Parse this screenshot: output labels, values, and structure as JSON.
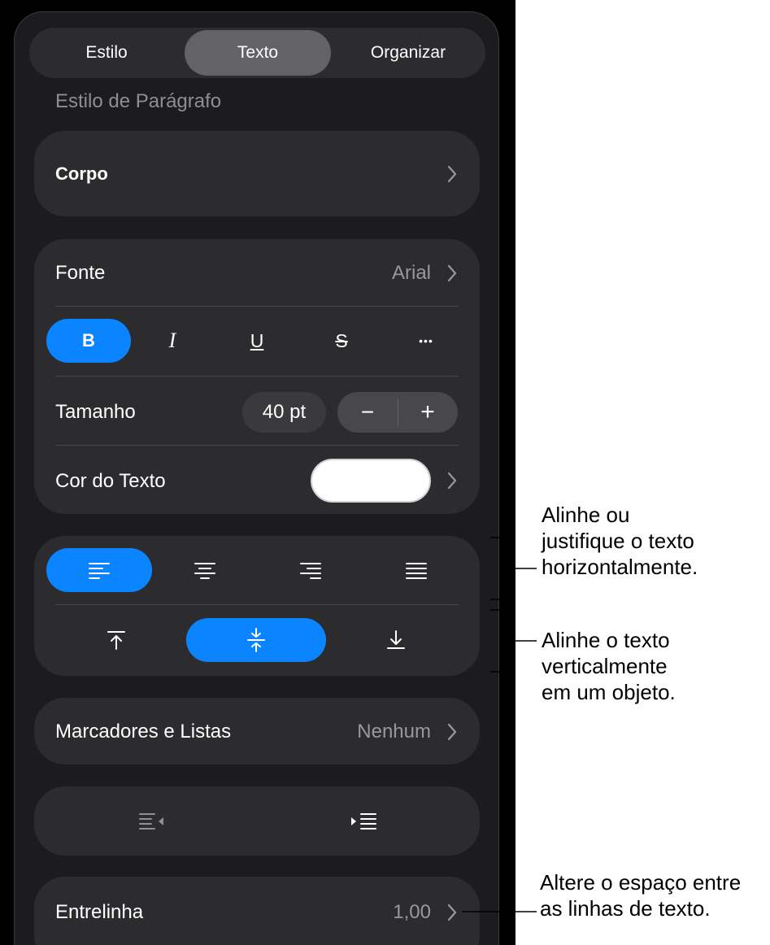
{
  "tabs": [
    {
      "label": "Estilo",
      "selected": false
    },
    {
      "label": "Texto",
      "selected": true
    },
    {
      "label": "Organizar",
      "selected": false
    }
  ],
  "paragraph_style": {
    "heading": "Estilo de Parágrafo",
    "value": "Corpo"
  },
  "font": {
    "label": "Fonte",
    "value": "Arial",
    "styles": [
      {
        "label": "B",
        "name": "bold",
        "active": true
      },
      {
        "label": "I",
        "name": "italic",
        "active": false
      },
      {
        "label": "U",
        "name": "underline",
        "active": false
      },
      {
        "label": "S",
        "name": "strikethrough",
        "active": false
      },
      {
        "label": "•••",
        "name": "more",
        "active": false
      }
    ]
  },
  "size": {
    "label": "Tamanho",
    "value": "40 pt",
    "minus": "−",
    "plus": "+"
  },
  "text_color": {
    "label": "Cor do Texto",
    "color": "#ffffff"
  },
  "alignment": {
    "horizontal": [
      "align-left",
      "align-center",
      "align-right",
      "justify"
    ],
    "horizontal_selected": "align-left",
    "vertical": [
      "align-top",
      "align-middle",
      "align-bottom"
    ],
    "vertical_selected": "align-middle"
  },
  "bullets": {
    "label": "Marcadores e Listas",
    "value": "Nenhum"
  },
  "indent": {
    "buttons": [
      "decrease-indent",
      "increase-indent"
    ]
  },
  "line_spacing": {
    "label": "Entrelinha",
    "value": "1,00"
  },
  "callouts": {
    "horizontal": [
      "Alinhe ou",
      "justifique o texto",
      "horizontalmente."
    ],
    "vertical": [
      "Alinhe o texto",
      "verticalmente",
      "em um objeto."
    ],
    "spacing": [
      "Altere o espaço entre",
      "as linhas de texto."
    ]
  },
  "colors": {
    "accent": "#0a84ff",
    "panel": "#1c1c1e",
    "card": "#2c2c2e"
  }
}
